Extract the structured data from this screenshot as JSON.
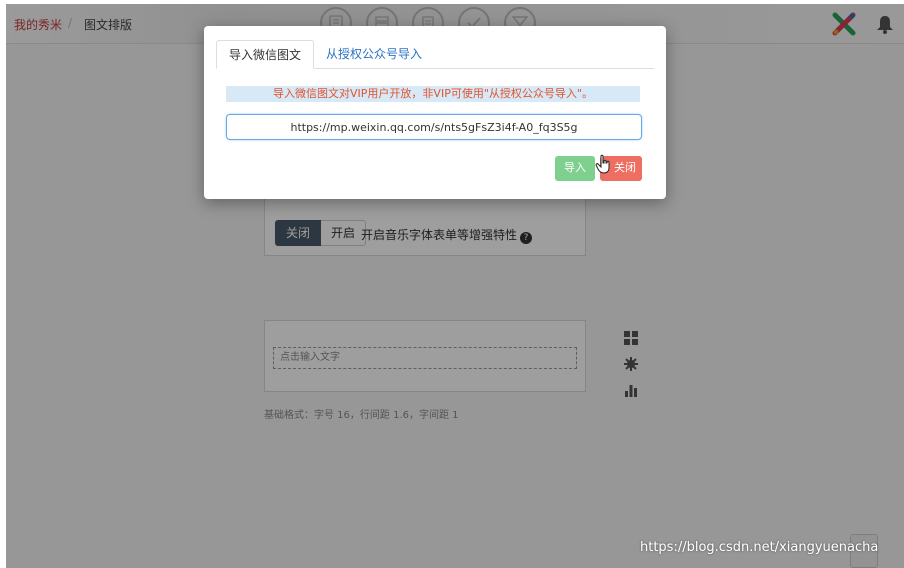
{
  "breadcrumb": {
    "home": "我的秀米",
    "sep": "/",
    "current": "图文排版"
  },
  "toolbar": {
    "icons": [
      "doc-icon",
      "stack-icon",
      "layers-icon",
      "check-icon",
      "filter-icon"
    ]
  },
  "editor": {
    "toggle_off": "关闭",
    "toggle_on": "开启",
    "feature_label": "开启音乐字体表单等增强特性",
    "text_placeholder": "点击输入文字",
    "base_format": "基础格式：字号 16，行间距 1.6，字间距 1"
  },
  "modal": {
    "tabs": [
      {
        "label": "导入微信图文",
        "active": true
      },
      {
        "label": "从授权公众号导入",
        "active": false
      }
    ],
    "notice": "导入微信图文对VIP用户开放，非VIP可使用\"从授权公众号导入\"。",
    "url_value": "https://mp.weixin.qq.com/s/nts5gFsZ3i4f-A0_fq3S5g",
    "import_label": "导入",
    "close_label": "关闭"
  },
  "watermark": "https://blog.csdn.net/xiangyuenacha",
  "colors": {
    "accent_red": "#c53a3a",
    "import_green": "#7fcf8f",
    "close_red": "#ee6f62",
    "link_blue": "#2a73c4",
    "notice_bg": "#d7e8f7"
  }
}
